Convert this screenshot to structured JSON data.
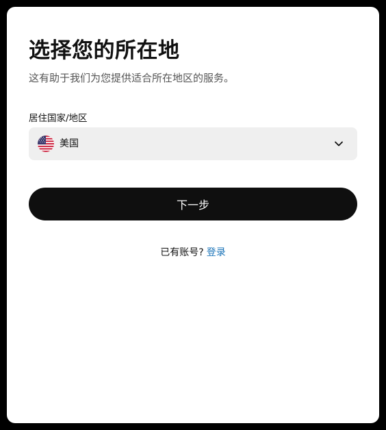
{
  "page": {
    "title": "选择您的所在地",
    "subtitle": "这有助于我们为您提供适合所在地区的服务。"
  },
  "country_field": {
    "label": "居住国家/地区",
    "selected_value": "美国",
    "flag_icon": "us-flag-icon",
    "dropdown_icon": "chevron-down-icon"
  },
  "next_button": {
    "label": "下一步"
  },
  "login": {
    "prompt": "已有账号?",
    "link_label": "登录"
  },
  "colors": {
    "background": "#000000",
    "card": "#ffffff",
    "select_background": "#efefef",
    "primary_button": "#0f0f0f",
    "link": "#1a73b8"
  }
}
